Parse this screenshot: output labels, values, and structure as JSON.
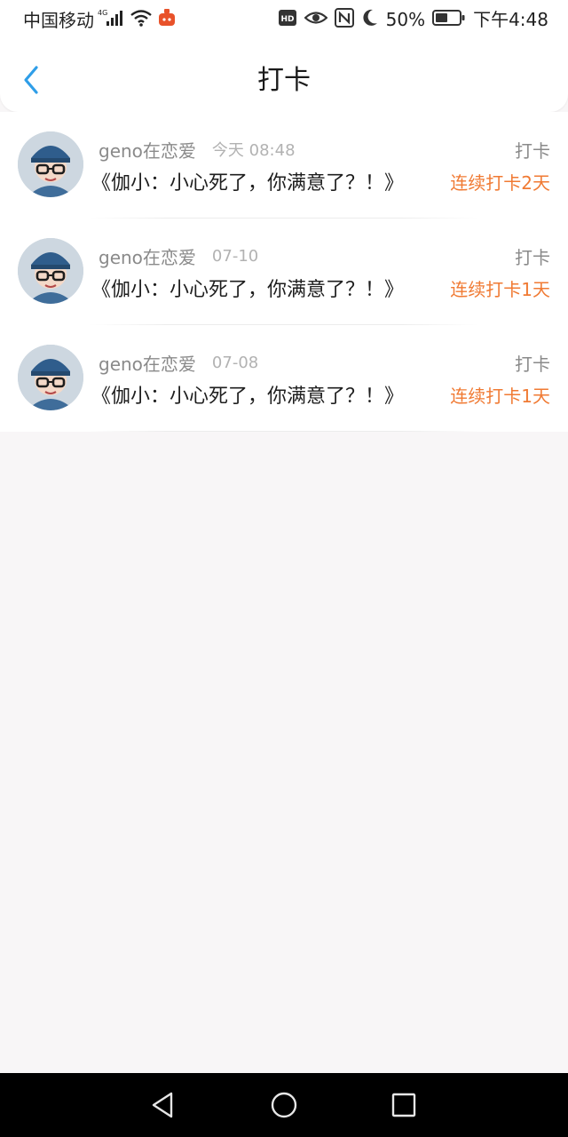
{
  "status_bar": {
    "carrier": "中国移动",
    "network": "4G",
    "battery_pct": "50%",
    "time": "下午4:48",
    "icons": [
      "signal-icon",
      "wifi-icon",
      "app-notification-icon",
      "hd-icon",
      "eye-icon",
      "nfc-icon",
      "moon-icon",
      "battery-icon"
    ]
  },
  "header": {
    "title": "打卡",
    "back_icon": "chevron-left-icon"
  },
  "checkins": [
    {
      "user": "geno在恋爱",
      "time": "今天 08:48",
      "tag": "打卡",
      "content": "《伽小：小心死了，你满意了？！》",
      "streak": "连续打卡2天"
    },
    {
      "user": "geno在恋爱",
      "time": "07-10",
      "tag": "打卡",
      "content": "《伽小：小心死了，你满意了？！》",
      "streak": "连续打卡1天"
    },
    {
      "user": "geno在恋爱",
      "time": "07-08",
      "tag": "打卡",
      "content": "《伽小：小心死了，你满意了？！》",
      "streak": "连续打卡1天"
    }
  ],
  "colors": {
    "accent": "#2f9ee8",
    "streak": "#f07a33",
    "page_bg": "#f8f6f7"
  },
  "system_nav": {
    "icons": [
      "back-triangle-icon",
      "home-circle-icon",
      "recents-square-icon"
    ]
  }
}
